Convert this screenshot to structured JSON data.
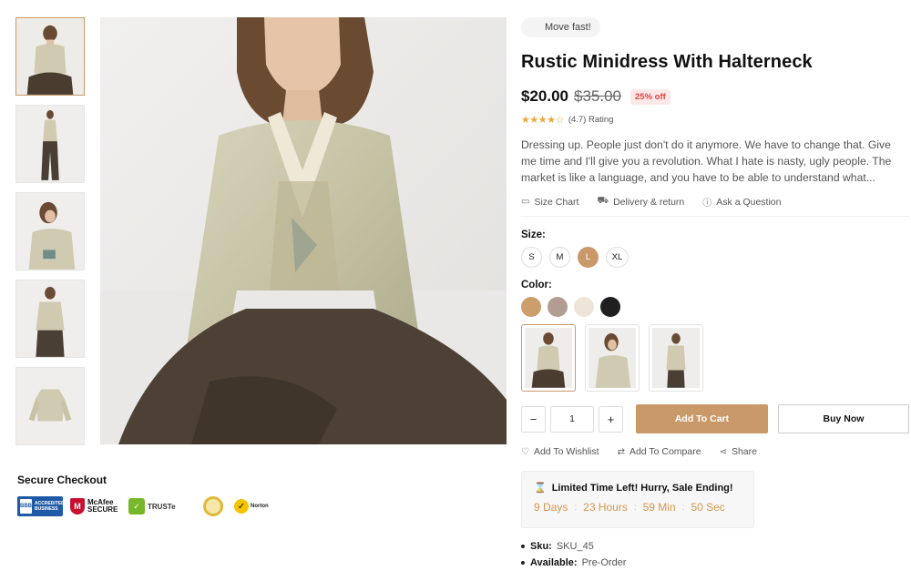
{
  "badge": {
    "text": "Move fast!",
    "icon": "lightning-icon"
  },
  "product": {
    "title": "Rustic Minidress With Halterneck",
    "price": "$20.00",
    "old_price": "$35.00",
    "discount": "25% off",
    "rating": {
      "value": 3.5,
      "label": "(4.7) Rating"
    },
    "description": "Dressing up. People just don't do it anymore. We have to change that. Give me time and I'll give you a revolution. What I hate is nasty, ugly people. The market is like a language, and you have to be able to understand what..."
  },
  "links": {
    "size_chart": "Size Chart",
    "delivery": "Delivery & return",
    "ask": "Ask a Question"
  },
  "size": {
    "label": "Size:",
    "options": [
      "S",
      "M",
      "L",
      "XL"
    ],
    "selected": "L"
  },
  "color": {
    "label": "Color:",
    "swatches": [
      "#cc9e6c",
      "#b39d92",
      "#efe4d8",
      "#1f1f1f"
    ]
  },
  "quantity": {
    "minus": "−",
    "value": "1",
    "plus": "+"
  },
  "buttons": {
    "add_to_cart": "Add To Cart",
    "buy_now": "Buy Now"
  },
  "actions": {
    "wishlist": "Add To Wishlist",
    "compare": "Add To Compare",
    "share": "Share"
  },
  "countdown": {
    "headline": "Limited Time Left! Hurry, Sale Ending!",
    "days": "9 Days",
    "hours": "23 Hours",
    "minutes": "59 Min",
    "seconds": "50 Sec",
    "separator": ":"
  },
  "meta": {
    "sku_label": "Sku:",
    "sku_value": "SKU_45",
    "availability_label": "Available:",
    "availability_value": "Pre-Order"
  },
  "secure": {
    "title": "Secure Checkout",
    "bbb_text": "ACCREDITED BUSINESS",
    "mcafee_text": "McAfee SECURE",
    "truste_text": "TRUSTe",
    "norton_text": "Norton"
  },
  "colors": {
    "accent": "#c9996a",
    "discount_bg": "#fde8e8",
    "discount_text": "#e1443f",
    "countdown_text": "#d6964d"
  }
}
